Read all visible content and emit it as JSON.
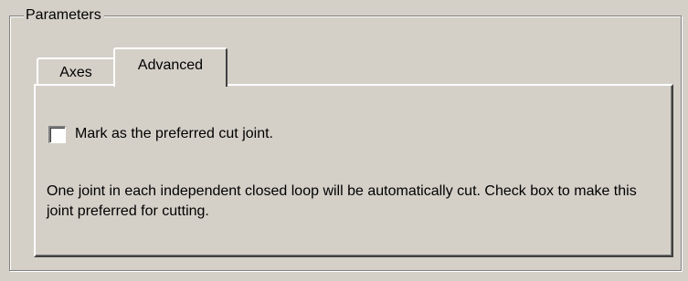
{
  "group": {
    "title": "Parameters"
  },
  "tabs": [
    {
      "label": "Axes",
      "selected": false
    },
    {
      "label": "Advanced",
      "selected": true
    }
  ],
  "advanced": {
    "checkbox_label": "Mark as the preferred cut joint.",
    "checkbox_checked": false,
    "description": "One joint in each independent closed loop will be automatically cut. Check box to make this joint preferred for cutting."
  },
  "colors": {
    "background": "#d4d0c8",
    "highlight": "#ffffff",
    "shadow": "#808080",
    "dark_shadow": "#404040"
  }
}
